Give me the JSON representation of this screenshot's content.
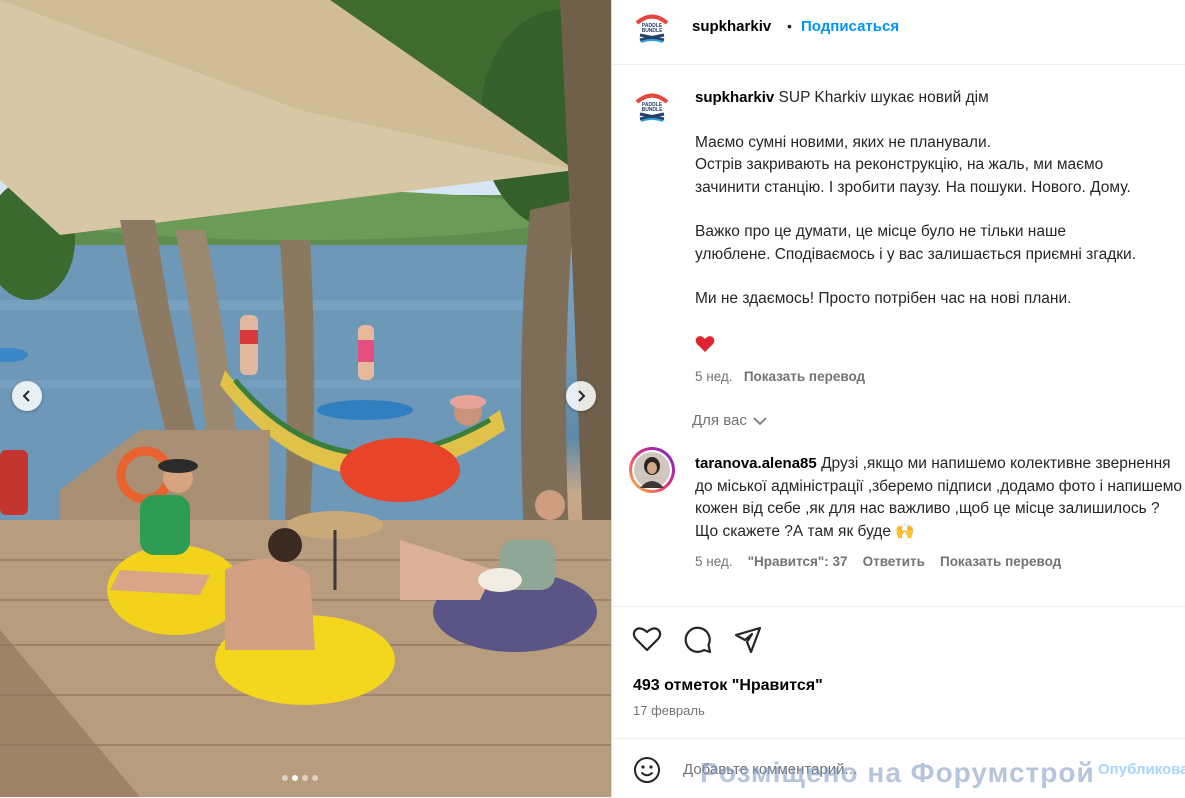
{
  "post": {
    "author": "supkharkiv",
    "separator": "•",
    "follow_label": "Подписаться",
    "caption": {
      "author": "supkharkiv",
      "title": "SUP Kharkiv шукає новий дім",
      "p1_l1": "Маємо сумні новими, яких не планували.",
      "p1_l2": "Острів закривають на реконструкцію, на жаль, ми маємо",
      "p1_l3": "зачинити станцію. І зробити паузу. На пошуки. Нового. Дому.",
      "p2_l1": "Важко про це думати, це місце було не тільки наше",
      "p2_l2": "улюблене. Сподіваємось і у вас залишається приємні згадки.",
      "p3": "Ми не здаємось! Просто потрібен час на нові плани.",
      "emoji": "❤️",
      "time": "5 нед.",
      "translate_label": "Показать перевод"
    },
    "for_you_label": "Для вас",
    "comment": {
      "author": "taranova.alena85",
      "text": "Друзі ,якщо ми напишемо колективне звернення до міської адміністрації ,зберемо підписи ,додамо фото і напишемо кожен від себе ,як для нас важливо ,щоб це місце залишилось ? Що скажете ?А там як буде 🙌",
      "time": "5 нед.",
      "likes": "\"Нравится\": 37",
      "reply_label": "Ответить",
      "translate_label": "Показать перевод"
    },
    "actions": {
      "like_icon": "heart-icon",
      "comment_icon": "comment-icon",
      "share_icon": "share-icon"
    },
    "likes_text": "493 отметок \"Нравится\"",
    "date": "17 февраль",
    "add_comment_placeholder": "Добавьте комментарий...",
    "publish_label": "Опубликовать"
  },
  "logo_text": "PADDLE BUNDLE",
  "carousel": {
    "current": 2,
    "total": 4
  },
  "watermark": "Розміщено на Форумстрой",
  "colors": {
    "link": "#0095f6",
    "muted": "#737373",
    "heart": "#ed4956"
  }
}
